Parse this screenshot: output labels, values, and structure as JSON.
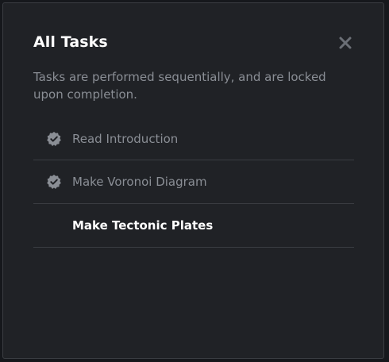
{
  "dialog": {
    "title": "All Tasks",
    "subtitle": "Tasks are performed sequentially, and are locked upon completion.",
    "close_icon": "close-icon"
  },
  "tasks": [
    {
      "label": "Read Introduction",
      "status": "completed",
      "icon": "check-badge-icon"
    },
    {
      "label": "Make Voronoi Diagram",
      "status": "completed",
      "icon": "check-badge-icon"
    },
    {
      "label": "Make Tectonic Plates",
      "status": "current",
      "icon": ""
    }
  ],
  "colors": {
    "background": "#202226",
    "title": "#ffffff",
    "muted_text": "#8a8e95",
    "divider": "#3a3d42"
  }
}
